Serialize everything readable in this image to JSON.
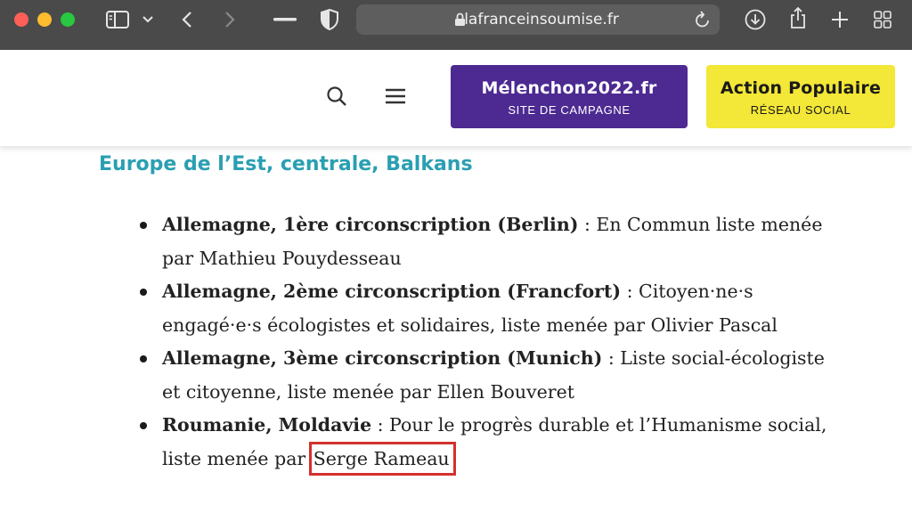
{
  "browser": {
    "url": "lafranceinsoumise.fr",
    "icons": [
      "sidebar-icon",
      "chevron-down-icon",
      "back-icon",
      "forward-icon",
      "minus-icon",
      "shield-icon",
      "lock-icon",
      "reload-icon",
      "download-icon",
      "share-icon",
      "plus-icon",
      "grid-icon"
    ]
  },
  "header": {
    "campaign_title": "Mélenchon2022.fr",
    "campaign_sub": "SITE DE CAMPAGNE",
    "popular_title": "Action Populaire",
    "popular_sub": "RÉSEAU SOCIAL",
    "colors": {
      "campaign": "#4d2a91",
      "popular": "#f3e737",
      "heading": "#2a9fb2",
      "highlight_box": "#d3302f"
    }
  },
  "content": {
    "heading": "Europe de l’Est, centrale, Balkans",
    "items": [
      {
        "bold": "Allemagne, 1ère circonscription (Berlin)",
        "text": " : En Commun liste menée par Mathieu Pouydesseau"
      },
      {
        "bold": "Allemagne, 2ème circonscription (Francfort)",
        "text": " : Citoyen·ne·s engagé·e·s écologistes et solidaires, liste menée par Olivier Pascal"
      },
      {
        "bold": "Allemagne, 3ème circonscription (Munich)",
        "text": " : Liste social-écologiste et citoyenne, liste menée par Ellen Bouveret"
      },
      {
        "bold": "Roumanie, Moldavie",
        "text": " : Pour le progrès durable et l’Humanisme social, liste menée par",
        "highlight": "Serge Rameau"
      }
    ]
  }
}
